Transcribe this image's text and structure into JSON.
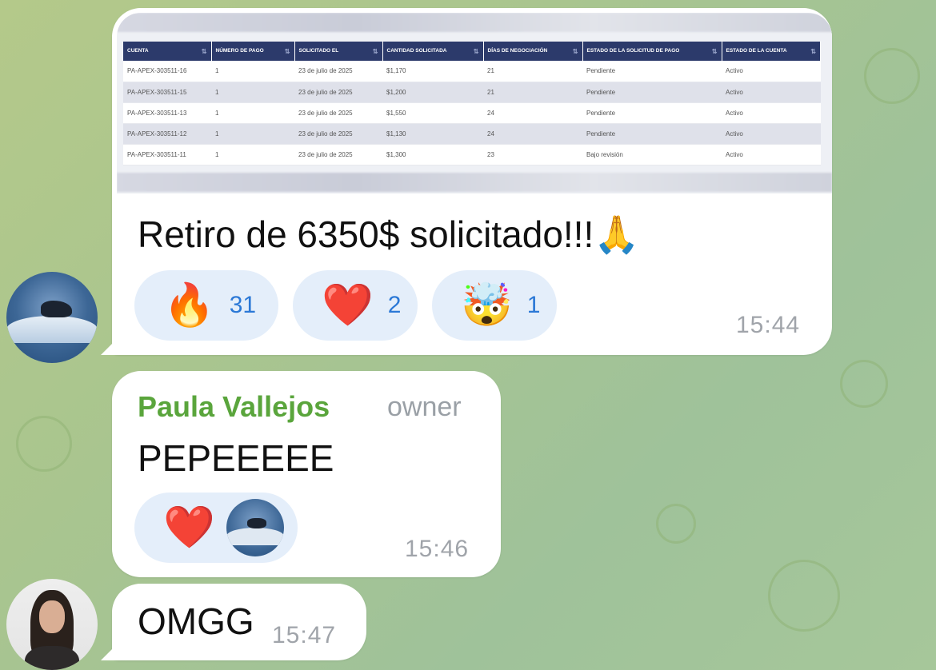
{
  "messages": {
    "first": {
      "table": {
        "headers": [
          "CUENTA",
          "NÚMERO DE PAGO",
          "SOLICITADO EL",
          "CANTIDAD SOLICITADA",
          "DÍAS DE NEGOCIACIÓN",
          "ESTADO DE LA SOLICITUD DE PAGO",
          "ESTADO DE LA CUENTA"
        ],
        "rows": [
          [
            "PA-APEX-303511-16",
            "1",
            "23 de julio de 2025",
            "$1,170",
            "21",
            "Pendiente",
            "Activo"
          ],
          [
            "PA-APEX-303511-15",
            "1",
            "23 de julio de 2025",
            "$1,200",
            "21",
            "Pendiente",
            "Activo"
          ],
          [
            "PA-APEX-303511-13",
            "1",
            "23 de julio de 2025",
            "$1,550",
            "24",
            "Pendiente",
            "Activo"
          ],
          [
            "PA-APEX-303511-12",
            "1",
            "23 de julio de 2025",
            "$1,130",
            "24",
            "Pendiente",
            "Activo"
          ],
          [
            "PA-APEX-303511-11",
            "1",
            "23 de julio de 2025",
            "$1,300",
            "23",
            "Bajo revisión",
            "Activo"
          ]
        ]
      },
      "text": "Retiro de 6350$ solicitado!!!",
      "text_emoji": "🙏",
      "reactions": [
        {
          "emoji": "🔥",
          "count": "31"
        },
        {
          "emoji": "❤️",
          "count": "2"
        },
        {
          "emoji": "🤯",
          "count": "1"
        }
      ],
      "time": "15:44"
    },
    "second": {
      "sender": "Paula Vallejos",
      "role": "owner",
      "text": "PEPEEEEE",
      "reaction_emoji": "❤️",
      "time": "15:46"
    },
    "third": {
      "text": "OMGG",
      "time": "15:47"
    }
  },
  "colors": {
    "sender_name": "#5aa53c",
    "reaction_count": "#2b78d6",
    "table_header": "#2c3a6b"
  }
}
